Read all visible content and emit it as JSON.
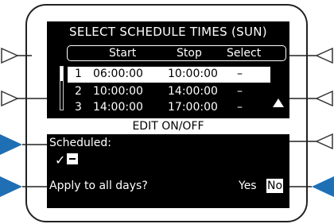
{
  "screen": {
    "title": "SELECT SCHEDULE TIMES (SUN)",
    "columns": [
      "Start",
      "Stop",
      "Select"
    ],
    "rows": [
      {
        "num": "1",
        "start": "06:00:00",
        "stop": "10:00:00",
        "select": "–"
      },
      {
        "num": "2",
        "start": "10:00:00",
        "stop": "14:00:00",
        "select": "–"
      },
      {
        "num": "3",
        "start": "14:00:00",
        "stop": "17:00:00",
        "select": "–"
      }
    ],
    "popup": {
      "title": "EDIT ON/OFF",
      "scheduled_label": "Scheduled:",
      "check_glyph": "✓",
      "apply_label": "Apply to all days?",
      "yes_label": "Yes",
      "no_label": "No"
    }
  },
  "colors": {
    "screen_bg": "#000000",
    "accent": "#1f6fb5",
    "bezel": "#222222"
  }
}
